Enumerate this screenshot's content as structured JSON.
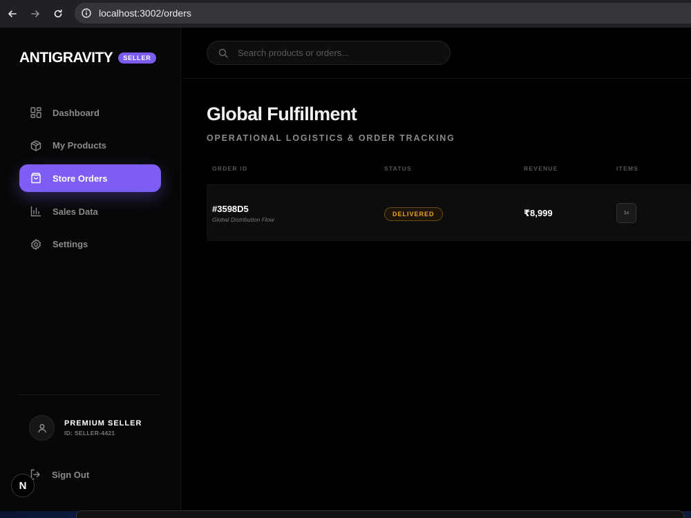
{
  "browser": {
    "url": "localhost:3002/orders"
  },
  "brand": {
    "name": "ANTIGRAVITY",
    "badge": "SELLER",
    "accent": "#7b5cf0"
  },
  "sidebar": {
    "items": [
      {
        "label": "Dashboard",
        "icon": "dashboard-icon"
      },
      {
        "label": "My Products",
        "icon": "package-icon"
      },
      {
        "label": "Store Orders",
        "icon": "shopping-bag-icon",
        "active": true
      },
      {
        "label": "Sales Data",
        "icon": "bar-chart-icon"
      },
      {
        "label": "Settings",
        "icon": "gear-icon"
      }
    ],
    "profile": {
      "name": "PREMIUM SELLER",
      "id": "ID: SELLER-4421"
    },
    "signout_label": "Sign Out",
    "next_badge": "N"
  },
  "search": {
    "placeholder": "Search products or orders..."
  },
  "page": {
    "title": "Global Fulfillment",
    "subtitle": "OPERATIONAL LOGISTICS & ORDER TRACKING"
  },
  "table": {
    "columns": [
      "ORDER ID",
      "STATUS",
      "REVENUE",
      "ITEMS"
    ],
    "rows": [
      {
        "order_id": "#3598D5",
        "flow": "Global Distribution Flow",
        "status": "DELIVERED",
        "status_color": "#f0a31e",
        "revenue": "₹8,999",
        "items": "1x"
      }
    ]
  }
}
